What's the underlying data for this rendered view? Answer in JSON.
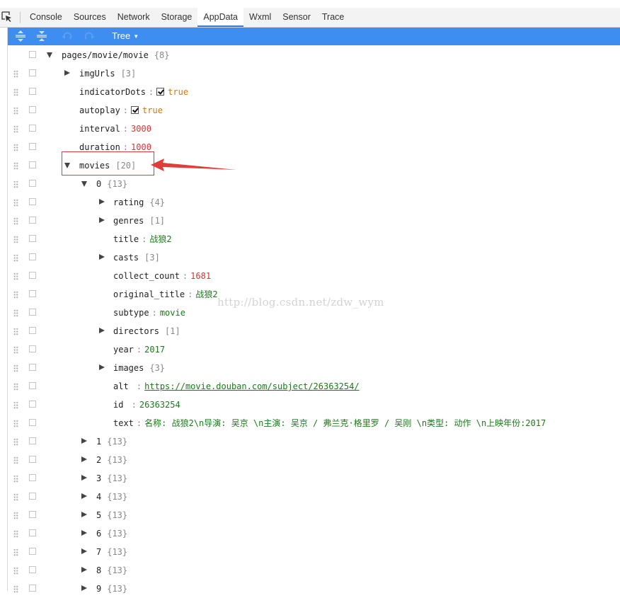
{
  "tabs": [
    {
      "label": "Console"
    },
    {
      "label": "Sources"
    },
    {
      "label": "Network"
    },
    {
      "label": "Storage"
    },
    {
      "label": "AppData",
      "active": true
    },
    {
      "label": "Wxml"
    },
    {
      "label": "Sensor"
    },
    {
      "label": "Trace"
    }
  ],
  "toolbar": {
    "mode_label": "Tree"
  },
  "watermark": "http://blog.csdn.net/zdw_wym",
  "colors": {
    "toolbar": "#3d8ef0",
    "highlight": "#e33a3a",
    "string": "#1a7a1a",
    "number": "#dd3333",
    "boolean": "#d07a0a"
  },
  "tree": [
    {
      "depth": 0,
      "toggle": "down",
      "key": "pages/movie/movie",
      "meta": "{8}",
      "grip": false
    },
    {
      "depth": 1,
      "toggle": "right",
      "key": "imgUrls",
      "meta": "[3]"
    },
    {
      "depth": 1,
      "key": "indicatorDots",
      "value": "true",
      "type": "bool",
      "checkbox": true
    },
    {
      "depth": 1,
      "key": "autoplay",
      "value": "true",
      "type": "bool",
      "checkbox": true
    },
    {
      "depth": 1,
      "key": "interval",
      "value": "3000",
      "type": "num"
    },
    {
      "depth": 1,
      "key": "duration",
      "value": "1000",
      "type": "num"
    },
    {
      "depth": 1,
      "toggle": "down",
      "key": "movies",
      "meta": "[20]",
      "highlighted": true
    },
    {
      "depth": 2,
      "toggle": "down",
      "key": "0",
      "meta": "{13}"
    },
    {
      "depth": 3,
      "toggle": "right",
      "key": "rating",
      "meta": "{4}"
    },
    {
      "depth": 3,
      "toggle": "right",
      "key": "genres",
      "meta": "[1]"
    },
    {
      "depth": 3,
      "key": "title",
      "value": "战狼2",
      "type": "str"
    },
    {
      "depth": 3,
      "toggle": "right",
      "key": "casts",
      "meta": "[3]"
    },
    {
      "depth": 3,
      "key": "collect_count",
      "value": "1681",
      "type": "num"
    },
    {
      "depth": 3,
      "key": "original_title",
      "value": "战狼2",
      "type": "str"
    },
    {
      "depth": 3,
      "key": "subtype",
      "value": "movie",
      "type": "str"
    },
    {
      "depth": 3,
      "toggle": "right",
      "key": "directors",
      "meta": "[1]"
    },
    {
      "depth": 3,
      "key": "year",
      "value": "2017",
      "type": "str"
    },
    {
      "depth": 3,
      "toggle": "right",
      "key": "images",
      "meta": "{3}"
    },
    {
      "depth": 3,
      "key": "alt ",
      "value": "https://movie.douban.com/subject/26363254/",
      "type": "link"
    },
    {
      "depth": 3,
      "key": "id  ",
      "value": "26363254",
      "type": "str"
    },
    {
      "depth": 3,
      "key": "text",
      "value": "名称: 战狼2\\n导演: 吴京 \\n主演: 吴京 / 弗兰克·格里罗 / 吴刚 \\n类型: 动作 \\n上映年份:2017",
      "type": "str"
    },
    {
      "depth": 2,
      "toggle": "right",
      "key": "1",
      "meta": "{13}"
    },
    {
      "depth": 2,
      "toggle": "right",
      "key": "2",
      "meta": "{13}"
    },
    {
      "depth": 2,
      "toggle": "right",
      "key": "3",
      "meta": "{13}"
    },
    {
      "depth": 2,
      "toggle": "right",
      "key": "4",
      "meta": "{13}"
    },
    {
      "depth": 2,
      "toggle": "right",
      "key": "5",
      "meta": "{13}"
    },
    {
      "depth": 2,
      "toggle": "right",
      "key": "6",
      "meta": "{13}"
    },
    {
      "depth": 2,
      "toggle": "right",
      "key": "7",
      "meta": "{13}"
    },
    {
      "depth": 2,
      "toggle": "right",
      "key": "8",
      "meta": "{13}"
    },
    {
      "depth": 2,
      "toggle": "right",
      "key": "9",
      "meta": "{13}"
    }
  ]
}
